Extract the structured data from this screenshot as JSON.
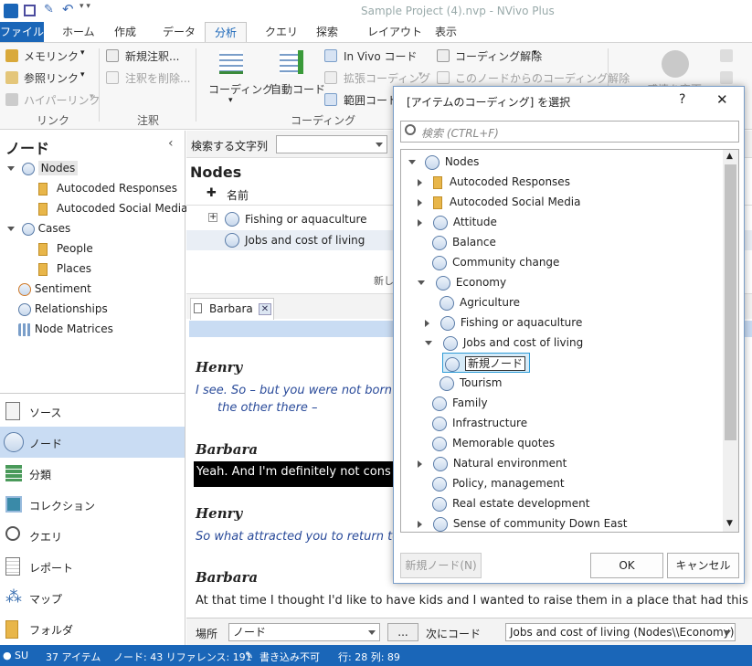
{
  "window": {
    "title": "Sample Project (4).nvp - NVivo Plus"
  },
  "tabs": [
    "ファイル",
    "ホーム",
    "作成",
    "データ",
    "分析",
    "クエリ",
    "探索",
    "レイアウト",
    "表示"
  ],
  "ribbon": {
    "memo_link": "メモリンク",
    "see_also_link": "参照リンク",
    "hyperlink": "ハイパーリンク",
    "group_link": "リンク",
    "new_annotation": "新規注釈...",
    "delete_annotation": "注釈を削除...",
    "group_annotation": "注釈",
    "coding": "コーディング",
    "auto_code": "自動コード",
    "in_vivo_code": "In Vivo コード",
    "extended_coding": "拡張コーディング",
    "range_code": "範囲コード",
    "uncode": "コーディング解除",
    "uncode_from_node": "このノードからのコーディング解除",
    "group_coding": "コーディング",
    "change_label": "感情を変更"
  },
  "nav": {
    "header": "ノード",
    "tree": {
      "nodes": "Nodes",
      "autocoded_responses": "Autocoded Responses",
      "autocoded_social": "Autocoded Social Media",
      "cases": "Cases",
      "people": "People",
      "places": "Places",
      "sentiment": "Sentiment",
      "relationships": "Relationships",
      "node_matrices": "Node Matrices"
    },
    "buttons": {
      "sources": "ソース",
      "nodes": "ノード",
      "classifications": "分類",
      "collections": "コレクション",
      "queries": "クエリ",
      "reports": "レポート",
      "maps": "マップ",
      "folders": "フォルダ"
    }
  },
  "center": {
    "search_label": "検索する文字列",
    "list_title": "Nodes",
    "col_name": "名前",
    "rows": [
      "Fishing or aquaculture",
      "Jobs and cost of living"
    ],
    "new_hint": "新し",
    "doc_tab": "Barbara",
    "transcript": {
      "speaker1": "Henry",
      "line1a": "I see. So – but you were not born",
      "line1b": "the other there –",
      "speaker2": "Barbara",
      "line2": "Yeah. And I'm definitely not cons",
      "speaker3": "Henry",
      "line3": "So what attracted you to return to",
      "speaker4": "Barbara",
      "line4": "At that time I thought I'd like to have kids and I wanted to raise them in a place that had this"
    },
    "bottom": {
      "location_label": "場所",
      "location_value": "ノード",
      "code_to_label": "次にコード",
      "code_to_value": "Jobs and cost of living (Nodes\\\\Economy)",
      "more": "..."
    }
  },
  "status": {
    "user": "SU",
    "items": "37 アイテム",
    "nodes_refs": "ノード: 43  リファレンス: 191",
    "readonly": "書き込み不可",
    "position": "行: 28  列: 89"
  },
  "dialog": {
    "title": "[アイテムのコーディング] を選択",
    "help": "?",
    "close": "✕",
    "search_placeholder": "検索 (CTRL+F)",
    "tree": {
      "root": "Nodes",
      "autocoded_responses": "Autocoded Responses",
      "autocoded_social": "Autocoded Social Media",
      "attitude": "Attitude",
      "balance": "Balance",
      "community_change": "Community change",
      "economy": "Economy",
      "agriculture": "Agriculture",
      "fishing": "Fishing or aquaculture",
      "jobs": "Jobs and cost of living",
      "new_node": "新規ノード",
      "tourism": "Tourism",
      "family": "Family",
      "infrastructure": "Infrastructure",
      "memorable_quotes": "Memorable quotes",
      "natural_environment": "Natural environment",
      "policy": "Policy, management",
      "real_estate": "Real estate development",
      "sense_of_community": "Sense of community Down East"
    },
    "new_node_button": "新規ノード(N)",
    "ok": "OK",
    "cancel": "キャンセル"
  },
  "colors": {
    "accent": "#1a66b8",
    "selection": "#c9dcf3"
  }
}
